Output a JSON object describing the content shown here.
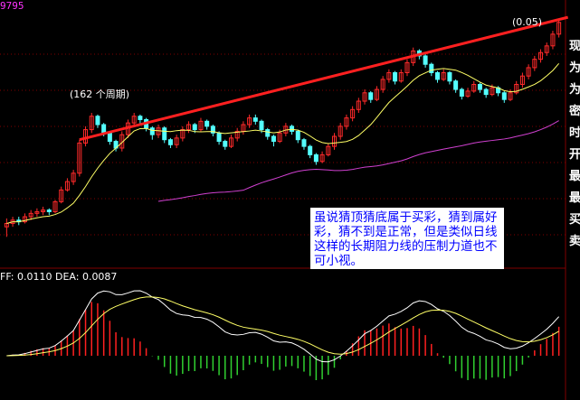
{
  "price_corner_label": "9795",
  "period_label": "(162 个周期)",
  "slope_label": "(0.05)",
  "macd_header": "FF: 0.0110 DEA: 0.0087",
  "annotation": "虽说猜顶猜底属于买彩，猜到属好彩，猜不到是正常，但是类似日线这样的长期阻力线的压制力道也不可小视。",
  "right_column_chars": [
    "现",
    "为",
    "为",
    "密",
    "时",
    "开",
    "最",
    "最",
    "买",
    "卖"
  ],
  "colors": {
    "background": "#000000",
    "candle_up": "#ff2a2a",
    "candle_down": "#54ffff",
    "resistance_line": "#ff2020",
    "ma_fast": "#ffff66",
    "ma_slow": "#d040d0",
    "macd_line": "#ffffff",
    "signal_line": "#ffff66",
    "hist_pos": "#ff2020",
    "hist_neg": "#30d030",
    "grid": "#800000"
  },
  "chart_data": {
    "type": "candlestick",
    "candles": [
      [
        70,
        72,
        64,
        75
      ],
      [
        72,
        74,
        70,
        76
      ],
      [
        74,
        73,
        71,
        76
      ],
      [
        73,
        76,
        72,
        78
      ],
      [
        76,
        78,
        74,
        80
      ],
      [
        78,
        79,
        76,
        81
      ],
      [
        79,
        80,
        77,
        82
      ],
      [
        80,
        79,
        77,
        81
      ],
      [
        79,
        85,
        78,
        86
      ],
      [
        85,
        92,
        84,
        94
      ],
      [
        92,
        97,
        91,
        99
      ],
      [
        97,
        102,
        95,
        104
      ],
      [
        102,
        120,
        100,
        122
      ],
      [
        120,
        128,
        118,
        130
      ],
      [
        128,
        136,
        126,
        138
      ],
      [
        136,
        131,
        129,
        137
      ],
      [
        131,
        126,
        124,
        132
      ],
      [
        126,
        121,
        119,
        127
      ],
      [
        121,
        117,
        115,
        122
      ],
      [
        117,
        125,
        115,
        127
      ],
      [
        125,
        132,
        123,
        134
      ],
      [
        132,
        136,
        130,
        138
      ],
      [
        136,
        134,
        131,
        137
      ],
      [
        134,
        129,
        127,
        135
      ],
      [
        129,
        125,
        122,
        130
      ],
      [
        125,
        129,
        123,
        131
      ],
      [
        129,
        122,
        120,
        130
      ],
      [
        122,
        119,
        117,
        123
      ],
      [
        119,
        123,
        117,
        125
      ],
      [
        123,
        128,
        121,
        130
      ],
      [
        128,
        131,
        126,
        133
      ],
      [
        131,
        128,
        126,
        132
      ],
      [
        128,
        133,
        127,
        135
      ],
      [
        133,
        130,
        128,
        134
      ],
      [
        130,
        126,
        124,
        131
      ],
      [
        126,
        121,
        119,
        127
      ],
      [
        121,
        118,
        116,
        122
      ],
      [
        118,
        123,
        117,
        125
      ],
      [
        123,
        127,
        121,
        129
      ],
      [
        127,
        131,
        125,
        133
      ],
      [
        131,
        135,
        129,
        137
      ],
      [
        135,
        133,
        131,
        137
      ],
      [
        133,
        128,
        126,
        134
      ],
      [
        128,
        124,
        122,
        129
      ],
      [
        124,
        121,
        118,
        125
      ],
      [
        121,
        126,
        120,
        128
      ],
      [
        126,
        130,
        124,
        132
      ],
      [
        130,
        127,
        125,
        131
      ],
      [
        127,
        122,
        120,
        128
      ],
      [
        122,
        118,
        116,
        123
      ],
      [
        118,
        113,
        111,
        119
      ],
      [
        113,
        109,
        107,
        114
      ],
      [
        109,
        113,
        108,
        115
      ],
      [
        113,
        118,
        112,
        120
      ],
      [
        118,
        124,
        116,
        126
      ],
      [
        124,
        130,
        122,
        132
      ],
      [
        130,
        135,
        128,
        137
      ],
      [
        135,
        140,
        133,
        142
      ],
      [
        140,
        145,
        138,
        147
      ],
      [
        145,
        150,
        143,
        152
      ],
      [
        150,
        146,
        144,
        151
      ],
      [
        146,
        152,
        145,
        154
      ],
      [
        152,
        158,
        150,
        160
      ],
      [
        158,
        162,
        156,
        164
      ],
      [
        162,
        157,
        155,
        163
      ],
      [
        157,
        162,
        156,
        164
      ],
      [
        162,
        168,
        160,
        170
      ],
      [
        168,
        175,
        166,
        177
      ],
      [
        175,
        172,
        170,
        176
      ],
      [
        172,
        167,
        165,
        173
      ],
      [
        167,
        162,
        160,
        168
      ],
      [
        162,
        158,
        156,
        163
      ],
      [
        158,
        162,
        157,
        164
      ],
      [
        162,
        157,
        155,
        163
      ],
      [
        157,
        152,
        150,
        158
      ],
      [
        152,
        148,
        146,
        153
      ],
      [
        148,
        151,
        147,
        153
      ],
      [
        151,
        155,
        150,
        157
      ],
      [
        155,
        152,
        150,
        156
      ],
      [
        152,
        149,
        147,
        153
      ],
      [
        149,
        153,
        148,
        155
      ],
      [
        153,
        150,
        148,
        154
      ],
      [
        150,
        146,
        144,
        151
      ],
      [
        146,
        150,
        145,
        152
      ],
      [
        150,
        155,
        149,
        157
      ],
      [
        155,
        160,
        153,
        162
      ],
      [
        160,
        165,
        158,
        167
      ],
      [
        165,
        170,
        163,
        172
      ],
      [
        170,
        174,
        168,
        176
      ],
      [
        174,
        178,
        172,
        180
      ],
      [
        178,
        185,
        176,
        187
      ],
      [
        185,
        192,
        183,
        194
      ]
    ],
    "price_range": [
      48,
      200
    ],
    "resistance_line": {
      "from_bar": 12,
      "to_bar": 91,
      "slope": 0.05
    },
    "macd": {
      "dif": 0.011,
      "dea": 0.0087
    }
  }
}
